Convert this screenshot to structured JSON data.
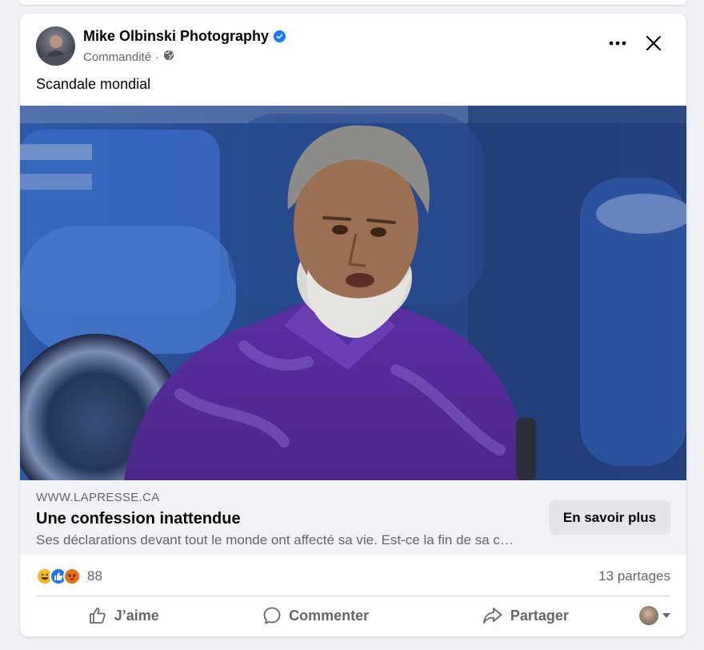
{
  "post": {
    "page_name": "Mike Olbinski Photography",
    "sponsored_label": "Commandité",
    "dot": "·",
    "caption": "Scandale mondial"
  },
  "link_preview": {
    "domain": "WWW.LAPRESSE.CA",
    "headline": "Une confession inattendue",
    "description": "Ses déclarations devant tout le monde ont affecté sa vie. Est-ce la fin de sa carrière?",
    "cta_label": "En savoir plus"
  },
  "stats": {
    "reaction_types": [
      "haha-icon",
      "like-icon",
      "angry-icon"
    ],
    "reaction_count": "88",
    "shares_label": "13 partages"
  },
  "actions": {
    "like_label": "J’aime",
    "comment_label": "Commenter",
    "share_label": "Partager"
  },
  "colors": {
    "verified_blue": "#1877f2",
    "like_blue": "#1877f2",
    "haha_yellow": "#f7b928",
    "angry_orange": "#e9710f",
    "text_secondary": "#65676b",
    "link_bar_bg": "#f0f2f5",
    "cta_bg": "#e4e6eb"
  }
}
